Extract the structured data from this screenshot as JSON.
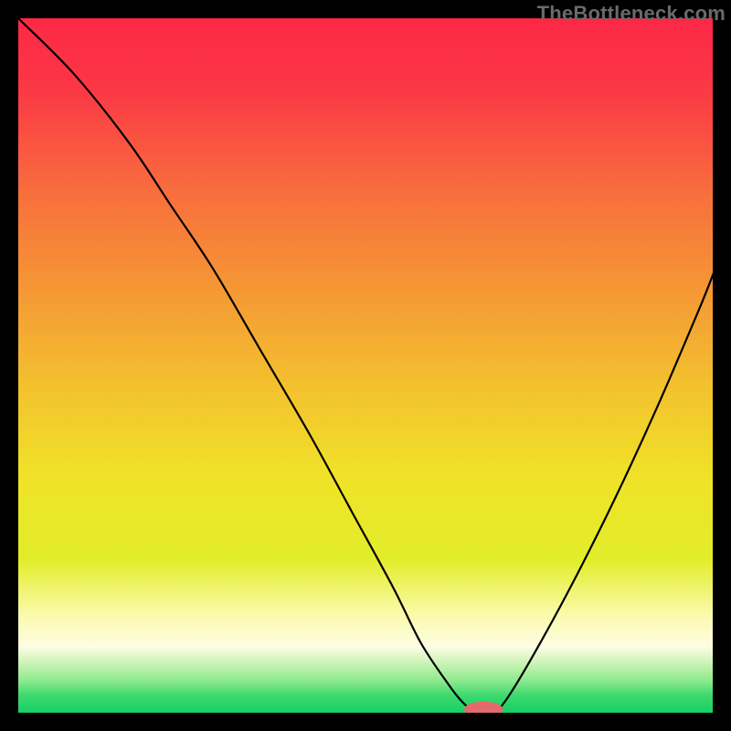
{
  "watermark": "TheBottleneck.com",
  "chart_data": {
    "type": "line",
    "title": "",
    "xlabel": "",
    "ylabel": "",
    "xlim": [
      0,
      100
    ],
    "ylim": [
      0,
      100
    ],
    "background_gradient": {
      "stops": [
        {
          "offset": 0.0,
          "color": "#fc2846"
        },
        {
          "offset": 0.1,
          "color": "#fb3745"
        },
        {
          "offset": 0.25,
          "color": "#f86e3d"
        },
        {
          "offset": 0.38,
          "color": "#f59435"
        },
        {
          "offset": 0.53,
          "color": "#f3c12e"
        },
        {
          "offset": 0.66,
          "color": "#f0e228"
        },
        {
          "offset": 0.78,
          "color": "#e2ed2a"
        },
        {
          "offset": 0.86,
          "color": "#fbfaae"
        },
        {
          "offset": 0.905,
          "color": "#fdfde3"
        },
        {
          "offset": 0.93,
          "color": "#c7f3b3"
        },
        {
          "offset": 0.955,
          "color": "#8ae98c"
        },
        {
          "offset": 0.975,
          "color": "#3dd96e"
        },
        {
          "offset": 1.0,
          "color": "#16d065"
        }
      ]
    },
    "series": [
      {
        "name": "bottleneck-curve",
        "color": "#000000",
        "stroke_width": 2.2,
        "x": [
          0,
          8,
          16,
          22,
          28,
          35,
          42,
          48,
          54,
          58,
          62,
          64,
          65.5,
          68.5,
          70,
          74,
          80,
          86,
          92,
          98,
          100
        ],
        "y": [
          100,
          92,
          82,
          73,
          64,
          52,
          40,
          29,
          18,
          10,
          4,
          1.5,
          0.5,
          0.5,
          1.5,
          8,
          19,
          31,
          44,
          58,
          63
        ]
      }
    ],
    "marker": {
      "name": "optimal-marker",
      "cx": 67,
      "cy": 0.5,
      "rx": 2.8,
      "ry": 1.1,
      "fill": "#e46a6d"
    }
  }
}
